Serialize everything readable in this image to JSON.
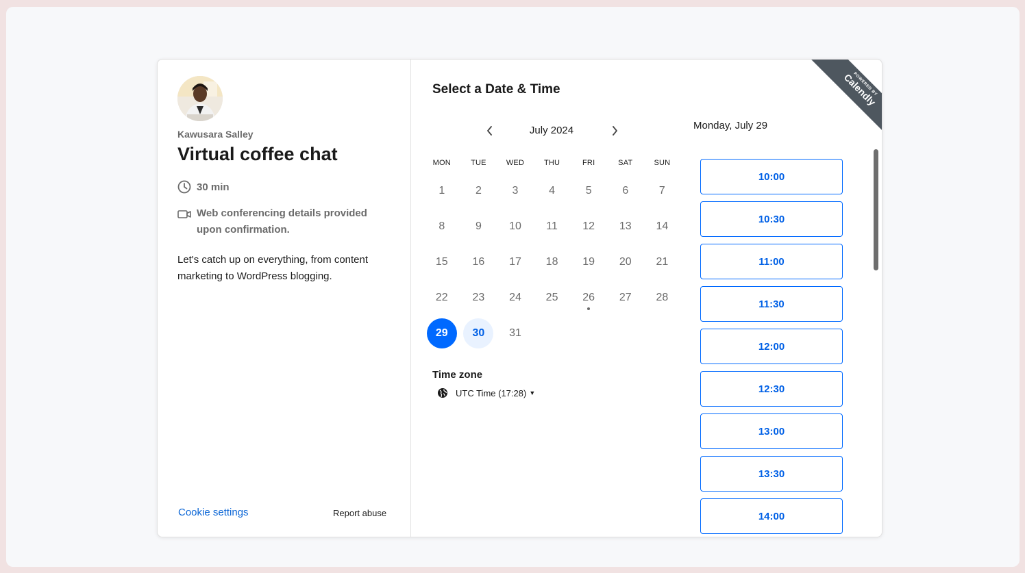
{
  "host": {
    "name": "Kawusara Salley"
  },
  "event": {
    "title": "Virtual coffee chat",
    "duration": "30 min",
    "conferencing": "Web conferencing details provided upon confirmation.",
    "description": "Let's catch up on everything, from content marketing to WordPress blogging."
  },
  "footer": {
    "cookie_settings": "Cookie settings",
    "report_abuse": "Report abuse"
  },
  "scheduler": {
    "heading": "Select a Date & Time",
    "month_label": "July 2024",
    "weekdays": [
      "MON",
      "TUE",
      "WED",
      "THU",
      "FRI",
      "SAT",
      "SUN"
    ],
    "weeks": [
      [
        "1",
        "2",
        "3",
        "4",
        "5",
        "6",
        "7"
      ],
      [
        "8",
        "9",
        "10",
        "11",
        "12",
        "13",
        "14"
      ],
      [
        "15",
        "16",
        "17",
        "18",
        "19",
        "20",
        "21"
      ],
      [
        "22",
        "23",
        "24",
        "25",
        "26",
        "27",
        "28"
      ],
      [
        "29",
        "30",
        "31",
        "",
        "",
        "",
        ""
      ]
    ],
    "selected_day": "29",
    "available_days": [
      "30"
    ],
    "today": "26",
    "timezone_label": "Time zone",
    "timezone_value": "UTC Time (17:28)",
    "selected_date_heading": "Monday, July 29",
    "slots": [
      "10:00",
      "10:30",
      "11:00",
      "11:30",
      "12:00",
      "12:30",
      "13:00",
      "13:30",
      "14:00"
    ]
  },
  "badge": {
    "powered_by": "POWERED BY",
    "brand": "Calendly"
  },
  "colors": {
    "accent": "#0069ff",
    "page_background": "#f1e2e2",
    "ribbon": "#4e575f"
  }
}
